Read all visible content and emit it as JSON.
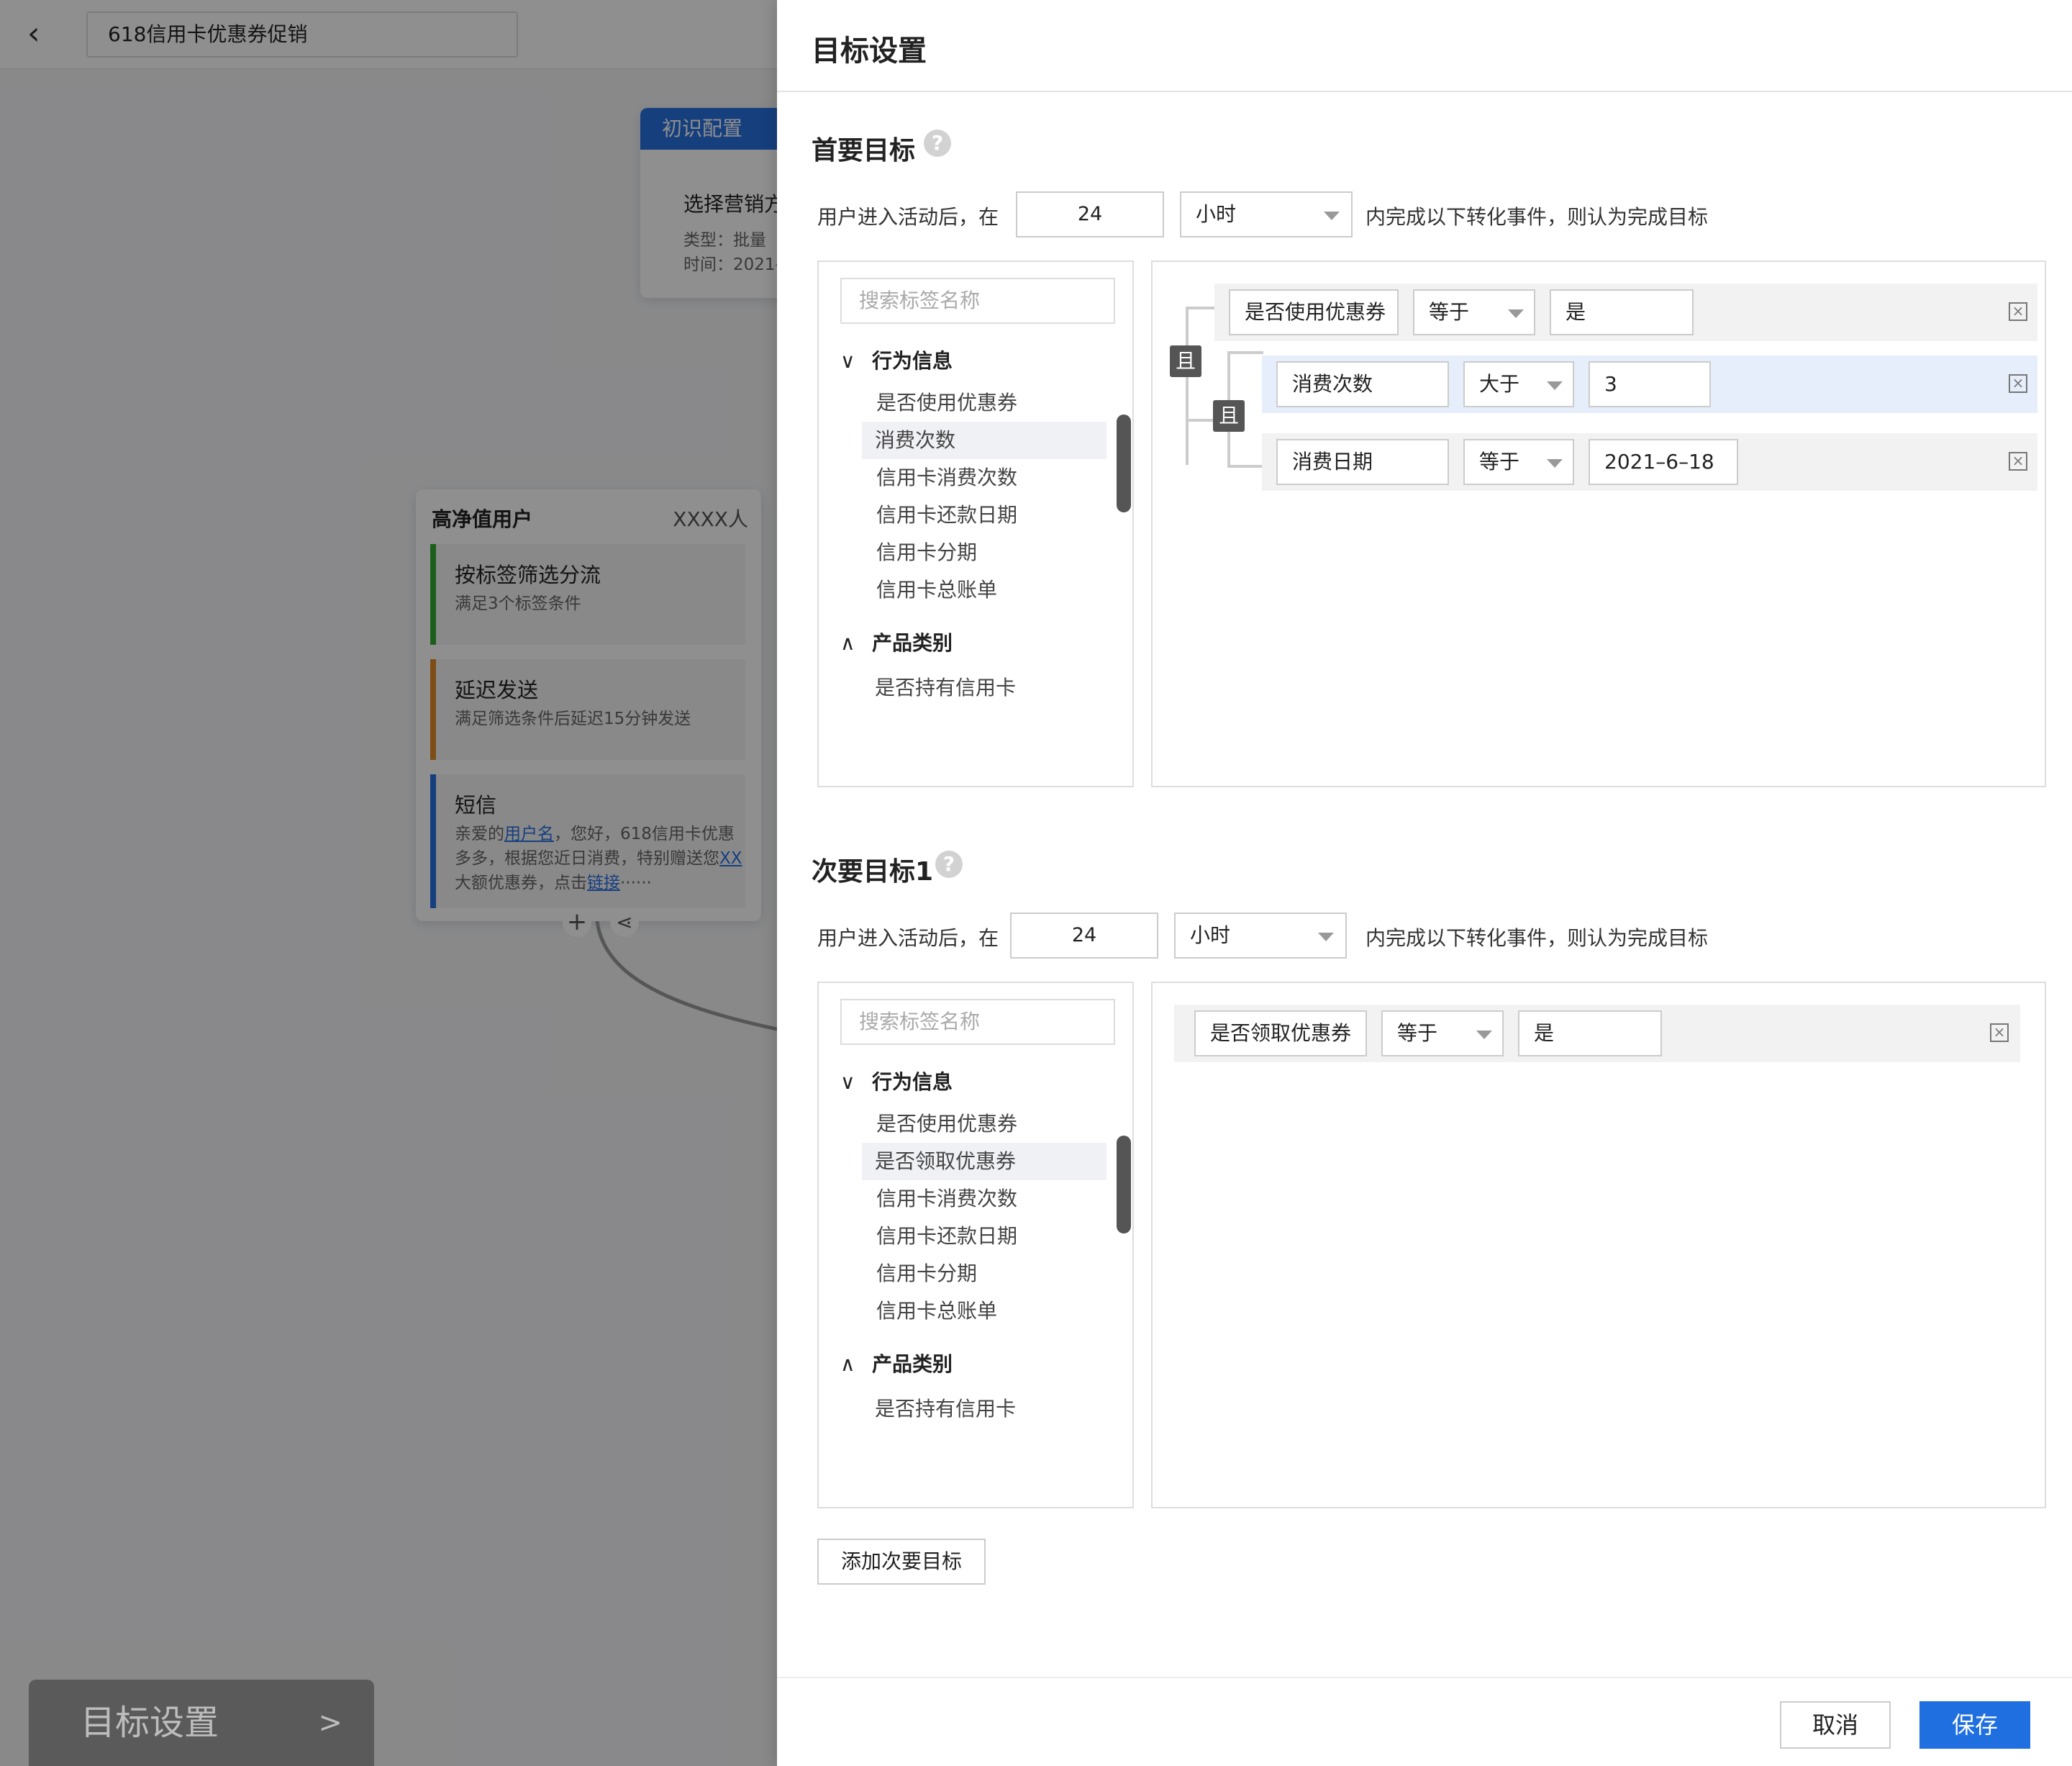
{
  "background": {
    "campaign_title": "618信用卡优惠券促销",
    "card1": {
      "header": "初识配置",
      "title": "选择营销方",
      "line1": "类型：批量",
      "line2": "时间：2021-"
    },
    "card2": {
      "title": "高净值用户",
      "count": "XXXX人",
      "nodes": [
        {
          "title": "按标签筛选分流",
          "sub": "满足3个标签条件"
        },
        {
          "title": "延迟发送",
          "sub": "满足筛选条件后延迟15分钟发送"
        },
        {
          "title": "短信",
          "sub_pre": "亲爱的",
          "sub_link1": "用户名",
          "sub_mid": "，您好，618信用卡优惠多多，根据您近日消费，特别赠送您",
          "sub_link2": "XX",
          "sub_mid2": "大额优惠券，点击",
          "sub_link3": "链接",
          "sub_end": "······"
        }
      ]
    },
    "goal_button": "目标设置",
    "goal_button_arrow": ">"
  },
  "drawer": {
    "title": "目标设置",
    "primary": {
      "title": "首要目标",
      "sentence_pre": "用户进入活动后，在",
      "hours": "24",
      "unit": "小时",
      "sentence_post": "内完成以下转化事件，则认为完成目标",
      "search_placeholder": "搜索标签名称",
      "group1": "行为信息",
      "group1_items": [
        "是否使用优惠券",
        "消费次数",
        "信用卡消费次数",
        "信用卡还款日期",
        "信用卡分期",
        "信用卡总账单"
      ],
      "group2": "产品类别",
      "group2_items": [
        "是否持有信用卡"
      ],
      "and_label": "且",
      "conditions": [
        {
          "field": "是否使用优惠券",
          "op": "等于",
          "value": "是"
        },
        {
          "field": "消费次数",
          "op": "大于",
          "value": "3"
        },
        {
          "field": "消费日期",
          "op": "等于",
          "value": "2021–6–18"
        }
      ]
    },
    "secondary": {
      "title": "次要目标1",
      "sentence_pre": "用户进入活动后，在",
      "hours": "24",
      "unit": "小时",
      "sentence_post": "内完成以下转化事件，则认为完成目标",
      "search_placeholder": "搜索标签名称",
      "group1": "行为信息",
      "group1_items": [
        "是否使用优惠券",
        "是否领取优惠券",
        "信用卡消费次数",
        "信用卡还款日期",
        "信用卡分期",
        "信用卡总账单"
      ],
      "group2": "产品类别",
      "group2_items": [
        "是否持有信用卡"
      ],
      "conditions": [
        {
          "field": "是否领取优惠券",
          "op": "等于",
          "value": "是"
        }
      ]
    },
    "add_secondary": "添加次要目标",
    "cancel": "取消",
    "save": "保存"
  },
  "icons": {
    "back": "chevron-left-icon",
    "help": "question-icon",
    "close": "close-box-icon",
    "expand": "chevron-down-icon",
    "collapse": "chevron-up-icon"
  },
  "colors": {
    "primary": "#1f6fe0",
    "node_green": "#33aa33",
    "node_orange": "#e08a2a",
    "node_blue": "#2870e0"
  }
}
